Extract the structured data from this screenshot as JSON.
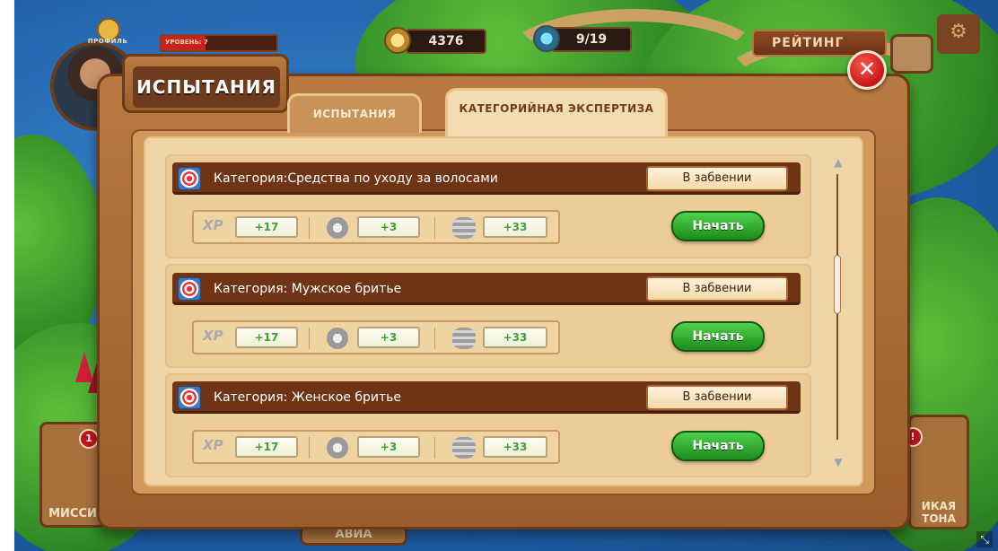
{
  "hud": {
    "profile_label": "ПРОФИЛЬ",
    "level_label": "УРОВЕНЬ: 7",
    "level_progress": 0.38,
    "coins": "4376",
    "gems": "9/19",
    "rating_label": "РЕЙТИНГ"
  },
  "bottom": {
    "left_button": "МИССИ",
    "left_badge": "1",
    "middle_button_1": "АВИА",
    "right_button": "ИКАЯ ТОНА",
    "right_badge": "!"
  },
  "modal": {
    "title": "ИСПЫТАНИЯ",
    "tabs": [
      {
        "label": "ИСПЫТАНИЯ",
        "active": false
      },
      {
        "label": "КАТЕГОРИЙНАЯ ЭКСПЕРТИЗА",
        "active": true
      }
    ],
    "close_label": "✕",
    "categories": [
      {
        "label": "Категория:Средства по уходу за волосами",
        "status": "В забвении",
        "xp_label": "XP",
        "xp": "+17",
        "medals": "+3",
        "coins": "+33",
        "action": "Начать"
      },
      {
        "label": "Категория: Мужское бритье",
        "status": "В забвении",
        "xp_label": "XP",
        "xp": "+17",
        "medals": "+3",
        "coins": "+33",
        "action": "Начать"
      },
      {
        "label": "Категория: Женское бритье",
        "status": "В забвении",
        "xp_label": "XP",
        "xp": "+17",
        "medals": "+3",
        "coins": "+33",
        "action": "Начать"
      }
    ]
  },
  "colors": {
    "accent_green": "#2aa62a",
    "header_brown": "#6f3416",
    "panel_tan": "#f0d6a6"
  }
}
